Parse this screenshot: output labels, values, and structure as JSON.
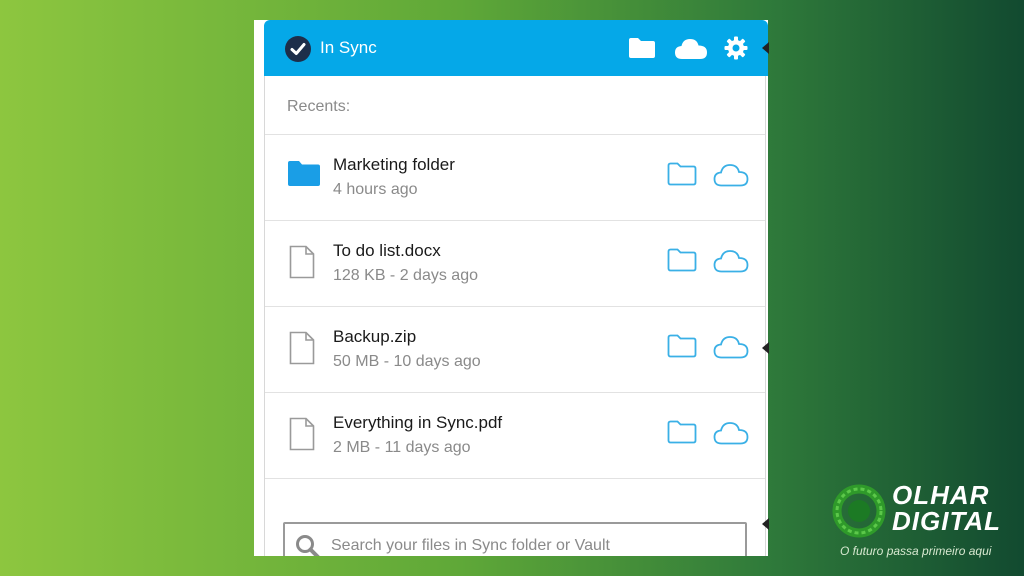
{
  "header": {
    "status": "In Sync",
    "icons": [
      "check-circle-icon",
      "folder-icon",
      "cloud-icon",
      "gear-icon"
    ]
  },
  "recents_label": "Recents:",
  "items": [
    {
      "name": "Marketing folder",
      "meta": "4 hours ago",
      "type": "folder"
    },
    {
      "name": "To do list.docx",
      "meta": "128 KB - 2 days ago",
      "type": "file"
    },
    {
      "name": "Backup.zip",
      "meta": "50 MB - 10 days ago",
      "type": "file"
    },
    {
      "name": "Everything in Sync.pdf",
      "meta": "2 MB - 11 days ago",
      "type": "file"
    }
  ],
  "search": {
    "placeholder": "Search your files in Sync folder or Vault",
    "value": ""
  },
  "watermark": {
    "line1": "OLHAR",
    "line2": "DIGITAL",
    "tagline": "O futuro passa primeiro aqui"
  },
  "colors": {
    "accent": "#05a8e8",
    "folder_blue": "#1a9ee6",
    "outline_blue": "#3ab0e6"
  }
}
